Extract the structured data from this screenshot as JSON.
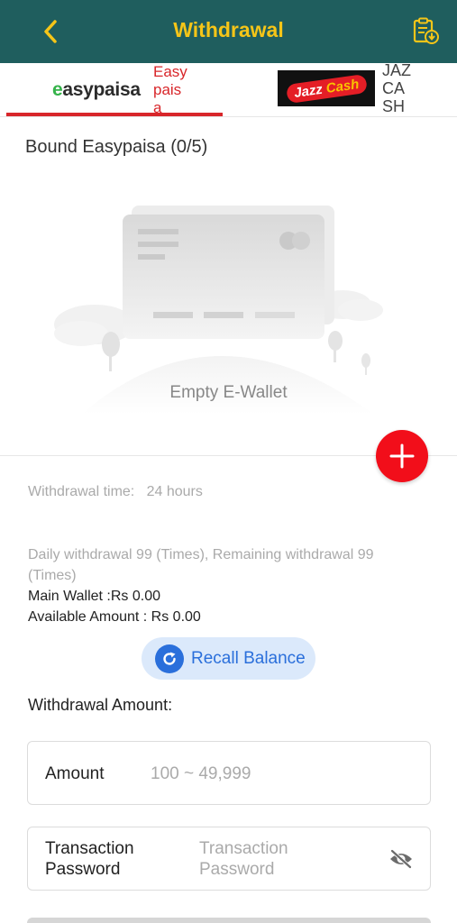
{
  "header": {
    "title": "Withdrawal",
    "back_icon": "chevron-left-icon",
    "records_icon": "clipboard-download-icon",
    "background": "#1f5e5e",
    "accent": "#f5c518"
  },
  "tabs": [
    {
      "logo_text": "easypaisa",
      "label": "Easypaisa",
      "active": true,
      "color": "#d8262a"
    },
    {
      "logo_text": "Jazz Cash",
      "label": "JAZ CA SH",
      "active": false
    }
  ],
  "bound": {
    "title": "Bound Easypaisa (0/5)",
    "empty_text": "Empty E-Wallet",
    "add_icon": "plus-icon",
    "add_color": "#f20e1a"
  },
  "info": {
    "withdrawal_time": "Withdrawal time:   24 hours",
    "daily_limit": "Daily withdrawal 99 (Times), Remaining withdrawal 99 (Times)",
    "main_wallet": "Main Wallet :Rs 0.00",
    "available_amount": "Available Amount : Rs 0.00"
  },
  "recall": {
    "label": "Recall Balance",
    "icon": "refresh-icon",
    "color": "#2a6fdb"
  },
  "form": {
    "section_label": "Withdrawal Amount:",
    "amount_label": "Amount",
    "amount_placeholder": "100 ~ 49,999",
    "password_label": "Transaction Password",
    "password_placeholder": "Transaction Password",
    "eye_icon": "eye-off-icon"
  }
}
